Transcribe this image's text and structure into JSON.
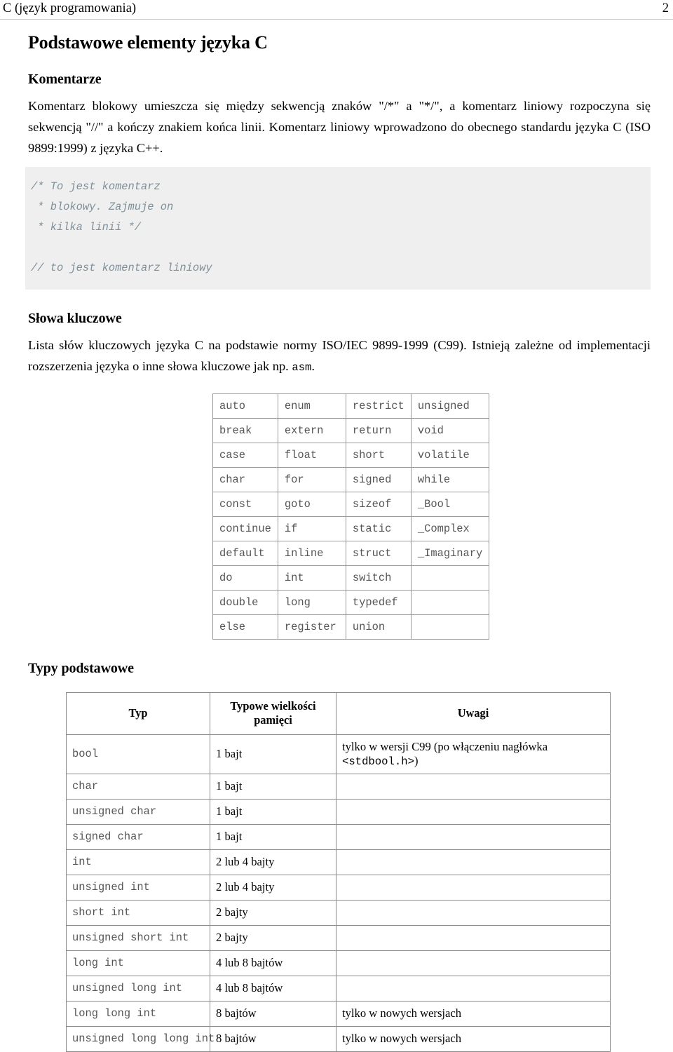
{
  "header": {
    "title": "C (język programowania)",
    "page_number": "2"
  },
  "doc": {
    "title": "Podstawowe elementy języka C"
  },
  "sections": {
    "comments": {
      "heading": "Komentarze",
      "paragraph": "Komentarz blokowy umieszcza się między sekwencją znaków \"/*\" a \"*/\", a komentarz liniowy rozpoczyna się sekwencją \"//\" a kończy znakiem końca linii. Komentarz liniowy wprowadzono do obecnego standardu języka C (ISO 9899:1999) z języka C++.",
      "code_block": "/* To jest komentarz\n * blokowy. Zajmuje on\n * kilka linii */\n\n// to jest komentarz liniowy"
    },
    "keywords": {
      "heading": "Słowa kluczowe",
      "paragraph_part1": "Lista słów kluczowych języka C na podstawie normy ISO/IEC 9899-1999 (C99). Istnieją zależne od implementacji rozszerzenia języka o inne słowa kluczowe jak np. ",
      "paragraph_code": "asm",
      "paragraph_part2": ".",
      "table_rows": [
        [
          "auto",
          "enum",
          "restrict",
          "unsigned"
        ],
        [
          "break",
          "extern",
          "return",
          "void"
        ],
        [
          "case",
          "float",
          "short",
          "volatile"
        ],
        [
          "char",
          "for",
          "signed",
          "while"
        ],
        [
          "const",
          "goto",
          "sizeof",
          "_Bool"
        ],
        [
          "continue",
          "if",
          "static",
          "_Complex"
        ],
        [
          "default",
          "inline",
          "struct",
          "_Imaginary"
        ],
        [
          "do",
          "int",
          "switch",
          ""
        ],
        [
          "double",
          "long",
          "typedef",
          ""
        ],
        [
          "else",
          "register",
          "union",
          ""
        ]
      ]
    },
    "types": {
      "heading": "Typy podstawowe",
      "columns": [
        "Typ",
        "Typowe wielkości pamięci",
        "Uwagi"
      ],
      "rows": [
        {
          "type": "bool",
          "size": "1 bajt",
          "note_pre": "tylko w wersji C99 (po włączeniu nagłówka ",
          "note_code": "<stdbool.h>",
          "note_post": ")"
        },
        {
          "type": "char",
          "size": "1 bajt",
          "note_pre": "",
          "note_code": "",
          "note_post": ""
        },
        {
          "type": "unsigned char",
          "size": "1 bajt",
          "note_pre": "",
          "note_code": "",
          "note_post": ""
        },
        {
          "type": "signed char",
          "size": "1 bajt",
          "note_pre": "",
          "note_code": "",
          "note_post": ""
        },
        {
          "type": "int",
          "size": "2 lub 4 bajty",
          "note_pre": "",
          "note_code": "",
          "note_post": ""
        },
        {
          "type": "unsigned int",
          "size": "2 lub 4 bajty",
          "note_pre": "",
          "note_code": "",
          "note_post": ""
        },
        {
          "type": "short int",
          "size": "2 bajty",
          "note_pre": "",
          "note_code": "",
          "note_post": ""
        },
        {
          "type": "unsigned short int",
          "size": "2 bajty",
          "note_pre": "",
          "note_code": "",
          "note_post": ""
        },
        {
          "type": "long int",
          "size": "4 lub 8 bajtów",
          "note_pre": "",
          "note_code": "",
          "note_post": ""
        },
        {
          "type": "unsigned long int",
          "size": "4 lub 8 bajtów",
          "note_pre": "",
          "note_code": "",
          "note_post": ""
        },
        {
          "type": "long long int",
          "size": "8 bajtów",
          "note_pre": "tylko w nowych wersjach",
          "note_code": "",
          "note_post": ""
        },
        {
          "type": "unsigned long long int",
          "size": "8 bajtów",
          "note_pre": "tylko w nowych wersjach",
          "note_code": "",
          "note_post": ""
        }
      ]
    }
  },
  "colors": {
    "code_background": "#efefef",
    "code_text": "#7e8f99",
    "mono_text": "#555555",
    "rule": "#c8c8c8",
    "table_border": "#8a8a8a"
  }
}
